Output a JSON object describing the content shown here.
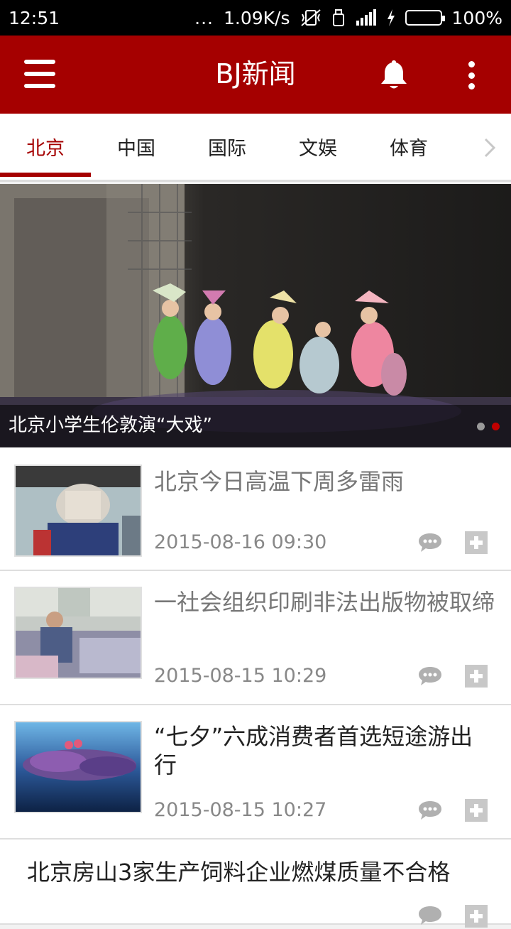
{
  "status_bar": {
    "time": "12:51",
    "dots": "...",
    "speed": "1.09K/s",
    "battery": "100%",
    "battery_color": "#4fc73b"
  },
  "app_bar": {
    "title": "BJ新闻",
    "background": "#a50000",
    "menu_icon": "hamburger-menu-icon",
    "bell_icon": "bell-icon",
    "more_icon": "more-vert-icon"
  },
  "tabs": [
    {
      "label": "北京",
      "active": true
    },
    {
      "label": "中国",
      "active": false
    },
    {
      "label": "国际",
      "active": false
    },
    {
      "label": "文娱",
      "active": false
    },
    {
      "label": "体育",
      "active": false
    }
  ],
  "hero": {
    "caption": "北京小学生伦敦演“大戏”",
    "page_count": 2,
    "active_page": 2
  },
  "news": [
    {
      "title": "北京今日高温下周多雷雨",
      "date": "2015-08-16 09:30",
      "read": true
    },
    {
      "title": "一社会组织印刷非法出版物被取缔",
      "date": "2015-08-15 10:29",
      "read": true
    },
    {
      "title": "“七夕”六成消费者首选短途游出行",
      "date": "2015-08-15 10:27",
      "read": false
    },
    {
      "title": "北京房山3家生产饲料企业燃煤质量不合格",
      "date": "",
      "read": false
    }
  ]
}
